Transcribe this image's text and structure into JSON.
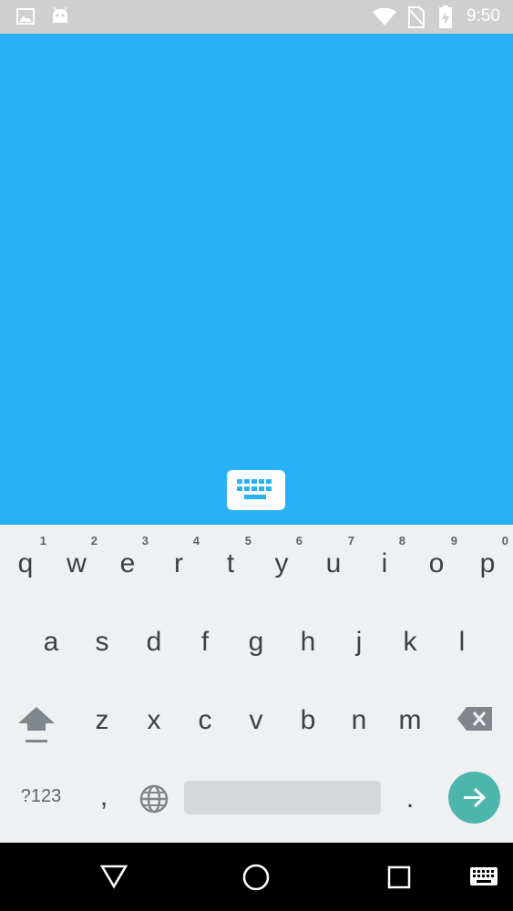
{
  "status_bar": {
    "time": "9:50",
    "icons_left": [
      "image-icon",
      "android-icon"
    ],
    "icons_right": [
      "wifi-icon",
      "no-sim-icon",
      "battery-charging-icon"
    ]
  },
  "content": {
    "background_color": "#29B1F7"
  },
  "keyboard": {
    "row1": [
      {
        "label": "q",
        "hint": "1"
      },
      {
        "label": "w",
        "hint": "2"
      },
      {
        "label": "e",
        "hint": "3"
      },
      {
        "label": "r",
        "hint": "4"
      },
      {
        "label": "t",
        "hint": "5"
      },
      {
        "label": "y",
        "hint": "6"
      },
      {
        "label": "u",
        "hint": "7"
      },
      {
        "label": "i",
        "hint": "8"
      },
      {
        "label": "o",
        "hint": "9"
      },
      {
        "label": "p",
        "hint": "0"
      }
    ],
    "row2": [
      "a",
      "s",
      "d",
      "f",
      "g",
      "h",
      "j",
      "k",
      "l"
    ],
    "row3": [
      "z",
      "x",
      "c",
      "v",
      "b",
      "n",
      "m"
    ],
    "symbols_label": "?123",
    "comma_label": ",",
    "period_label": ".",
    "accent_color": "#4DB6AC"
  },
  "nav_bar": {
    "buttons": [
      "back-icon",
      "home-icon",
      "recents-icon",
      "keyboard-switch-icon"
    ]
  }
}
